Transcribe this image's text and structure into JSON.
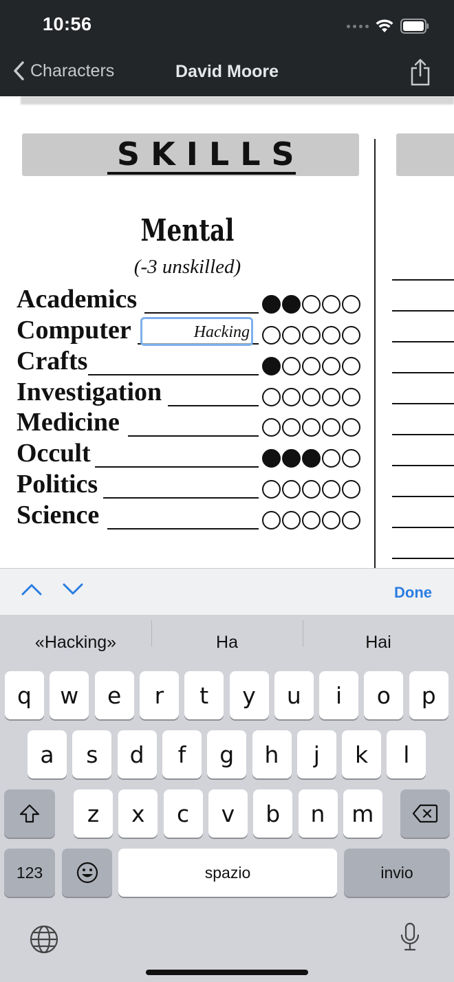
{
  "status": {
    "time": "10:56"
  },
  "nav": {
    "back_label": "Characters",
    "title": "David Moore"
  },
  "sheet": {
    "section_title": "SKILLS",
    "category": "Mental",
    "category_note": "(-3 unskilled)",
    "skills": [
      {
        "name": "Academics",
        "dots": 2,
        "max": 5
      },
      {
        "name": "Computer",
        "dots": 0,
        "max": 5,
        "specialty": "Hacking"
      },
      {
        "name": "Crafts",
        "dots": 1,
        "max": 5
      },
      {
        "name": "Investigation",
        "dots": 0,
        "max": 5
      },
      {
        "name": "Medicine",
        "dots": 0,
        "max": 5
      },
      {
        "name": "Occult",
        "dots": 3,
        "max": 5
      },
      {
        "name": "Politics",
        "dots": 0,
        "max": 5
      },
      {
        "name": "Science",
        "dots": 0,
        "max": 5
      }
    ]
  },
  "accessory": {
    "done_label": "Done"
  },
  "keyboard": {
    "suggestions": [
      "«Hacking»",
      "Ha",
      "Hai"
    ],
    "row1": [
      "q",
      "w",
      "e",
      "r",
      "t",
      "y",
      "u",
      "i",
      "o",
      "p"
    ],
    "row2": [
      "a",
      "s",
      "d",
      "f",
      "g",
      "h",
      "j",
      "k",
      "l"
    ],
    "row3": [
      "z",
      "x",
      "c",
      "v",
      "b",
      "n",
      "m"
    ],
    "numbers_label": "123",
    "space_label": "spazio",
    "return_label": "invio"
  }
}
